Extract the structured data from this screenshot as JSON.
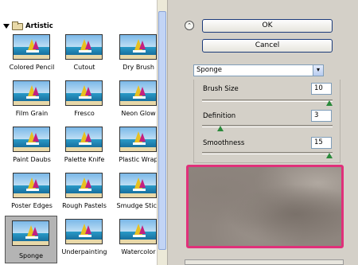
{
  "gallery": {
    "category": "Artistic",
    "filters": [
      {
        "label": "Colored Pencil",
        "selected": false
      },
      {
        "label": "Cutout",
        "selected": false
      },
      {
        "label": "Dry Brush",
        "selected": false
      },
      {
        "label": "Film Grain",
        "selected": false
      },
      {
        "label": "Fresco",
        "selected": false
      },
      {
        "label": "Neon Glow",
        "selected": false
      },
      {
        "label": "Paint Daubs",
        "selected": false
      },
      {
        "label": "Palette Knife",
        "selected": false
      },
      {
        "label": "Plastic Wrap",
        "selected": false
      },
      {
        "label": "Poster Edges",
        "selected": false
      },
      {
        "label": "Rough Pastels",
        "selected": false
      },
      {
        "label": "Smudge Stick",
        "selected": false
      },
      {
        "label": "Sponge",
        "selected": true
      },
      {
        "label": "Underpainting",
        "selected": false
      },
      {
        "label": "Watercolor",
        "selected": false
      }
    ]
  },
  "dialog": {
    "ok_label": "OK",
    "cancel_label": "Cancel",
    "filter_select": "Sponge"
  },
  "params": [
    {
      "label": "Brush Size",
      "value": "10",
      "fraction": 1.0
    },
    {
      "label": "Definition",
      "value": "3",
      "fraction": 0.12
    },
    {
      "label": "Smoothness",
      "value": "15",
      "fraction": 1.0
    }
  ],
  "colors": {
    "preview_border": "#e0307a",
    "slider_thumb": "#2a8a3a",
    "button_border": "#1c3b7a"
  }
}
